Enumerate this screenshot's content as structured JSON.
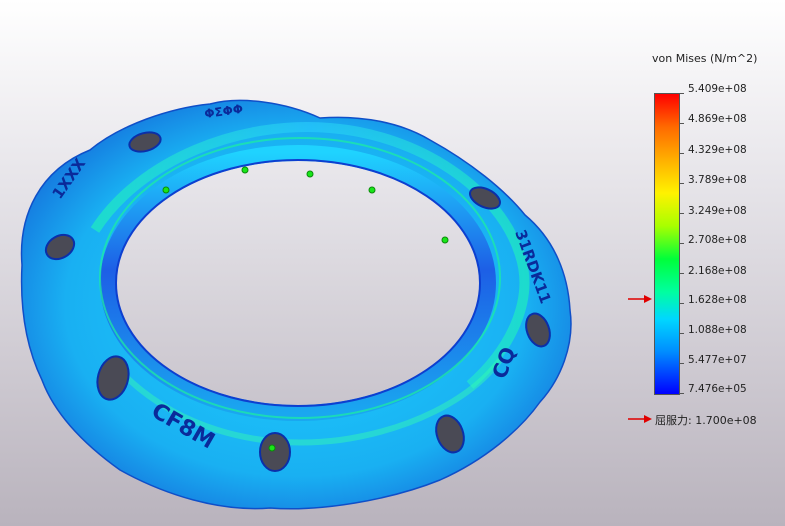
{
  "legend": {
    "title": "von Mises (N/m^2)",
    "ticks": [
      "5.409e+08",
      "4.869e+08",
      "4.329e+08",
      "3.789e+08",
      "3.249e+08",
      "2.708e+08",
      "2.168e+08",
      "1.628e+08",
      "1.088e+08",
      "5.477e+07",
      "7.476e+05"
    ],
    "yield_label": "屈服力: 1.700e+08",
    "yield_value": 170000000.0
  },
  "model_text": {
    "cf8m": "CF8M",
    "cq": "CQ",
    "dn": "31RDK11",
    "top": "ΦΣΦΦ",
    "left": "1XXX"
  },
  "colors": {
    "max": "#ff0000",
    "min": "#0000ff",
    "ring_base": "#1aa7f0",
    "arrow": "#e00000"
  }
}
